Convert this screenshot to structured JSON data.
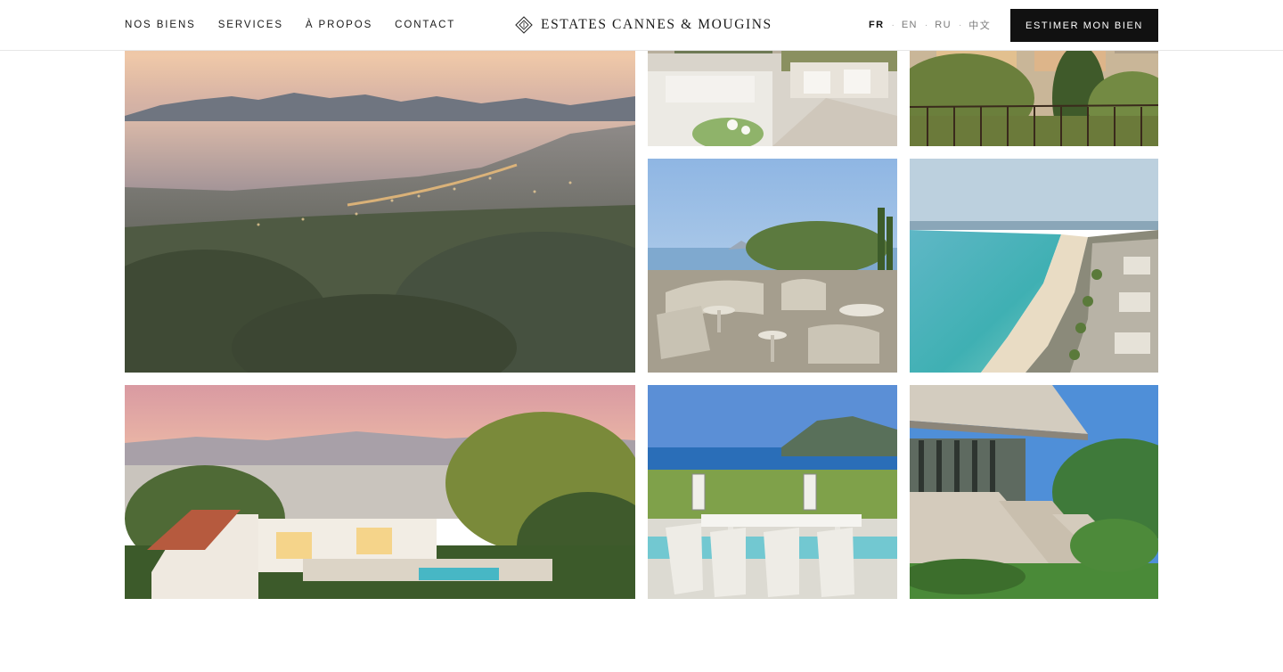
{
  "header": {
    "nav": [
      {
        "label": "NOS BIENS"
      },
      {
        "label": "SERVICES"
      },
      {
        "label": "À PROPOS"
      },
      {
        "label": "CONTACT"
      }
    ],
    "brand_name": "ESTATES CANNES & MOUGINS",
    "brand_icon": "diamond-logo-icon",
    "languages": [
      {
        "label": "FR",
        "active": true
      },
      {
        "label": "EN",
        "active": false
      },
      {
        "label": "RU",
        "active": false
      },
      {
        "label": "中文",
        "active": false
      }
    ],
    "language_separator": "·",
    "cta_label": "ESTIMER MON BIEN"
  },
  "gallery": {
    "images": [
      {
        "subject": "cannes-bay-sunset-view"
      },
      {
        "subject": "villa-living-room-terrace"
      },
      {
        "subject": "old-town-houses-garden"
      },
      {
        "subject": "terrace-lounge-sea-view"
      },
      {
        "subject": "croisette-beach-aerial"
      },
      {
        "subject": "villa-pool-dusk-aerial"
      },
      {
        "subject": "pool-dining-table-sea-view"
      },
      {
        "subject": "modern-villa-architecture"
      }
    ]
  },
  "colors": {
    "ink": "#111111",
    "muted": "#7a7a7a",
    "background": "#ffffff",
    "cta_background": "#111111",
    "cta_text": "#ffffff"
  }
}
